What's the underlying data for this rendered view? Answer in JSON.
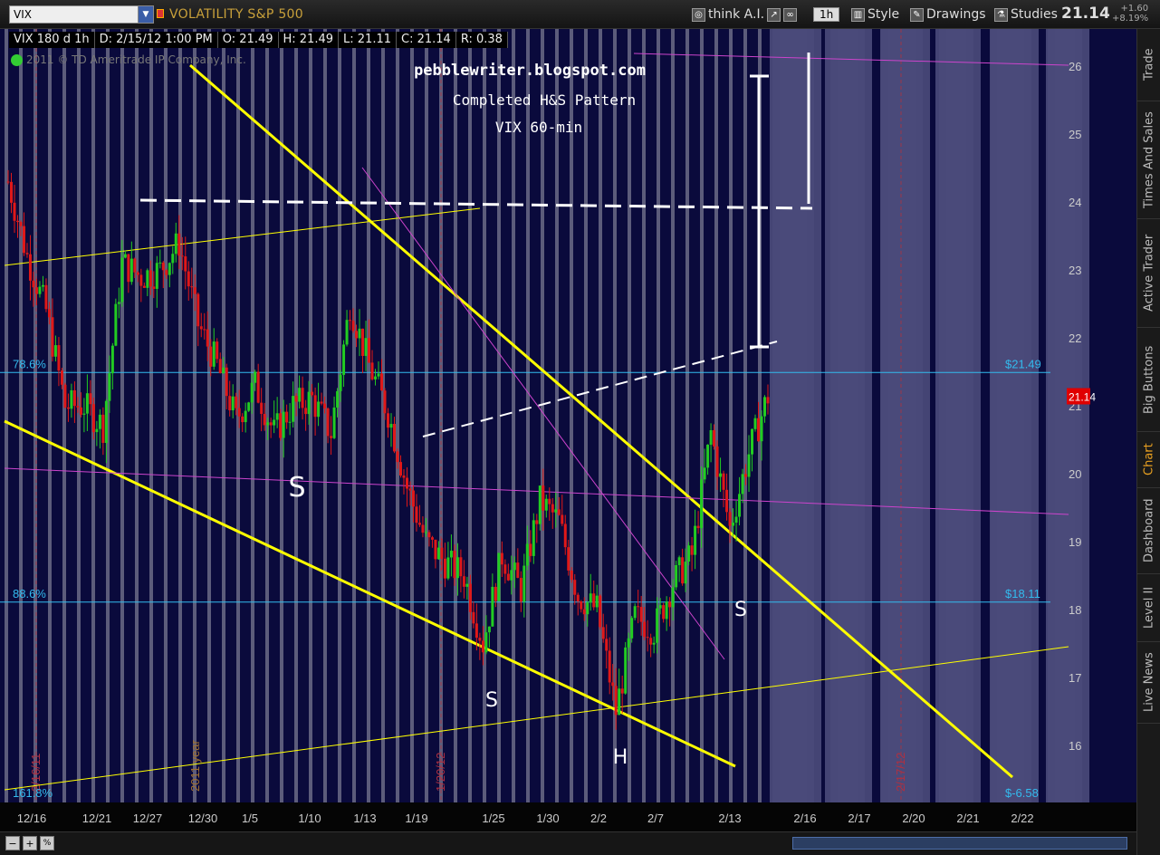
{
  "toolbar": {
    "symbol": "VIX",
    "description": "VOLATILITY S&P 500",
    "think_ai": "think A.I.",
    "period": "1h",
    "style": "Style",
    "drawings": "Drawings",
    "studies": "Studies",
    "last_price": "21.14",
    "net_change": "+1.60",
    "net_change_pct": "+8.19%"
  },
  "info_bar": {
    "symbol_period": "VIX 180 d 1h",
    "date": "D: 2/15/12 1:00 PM",
    "open": "O: 21.49",
    "high": "H: 21.49",
    "low": "L: 21.11",
    "close": "C: 21.14",
    "range": "R: 0.38"
  },
  "copyright": "2011 © TD Ameritrade IP Company, Inc.",
  "side_tabs": [
    "Trade",
    "Times And Sales",
    "Active Trader",
    "Big Buttons",
    "Chart",
    "Dashboard",
    "Level II",
    "Live News"
  ],
  "active_side_tab": "Chart",
  "bottom_bar": {
    "zoom_out": "−",
    "zoom_in": "+",
    "zoom_pct": "%"
  },
  "colors": {
    "background": "#0a0a3c",
    "stripe": "#787890",
    "future_stripe": "#4a4a7a",
    "up_candle": "#22cc22",
    "down_candle": "#e01818",
    "fib_line": "#33bbee",
    "trend_yellow": "#ffff00",
    "trend_magenta": "#cc44cc",
    "annotation": "#ffffff",
    "price_tag": "#e00000"
  },
  "chart_data": {
    "type": "candlestick",
    "title": "pebblewriter.blogspot.com",
    "subtitle_lines": [
      "Completed H&S Pattern",
      "VIX    60-min"
    ],
    "y_ticks": [
      16,
      17,
      18,
      19,
      20,
      21,
      22,
      23,
      24,
      25,
      26
    ],
    "x_ticks": [
      "12/16",
      "12/21",
      "12/27",
      "12/30",
      "1/5",
      "1/10",
      "1/13",
      "1/19",
      "1/25",
      "1/30",
      "2/2",
      "2/7",
      "2/13",
      "2/16",
      "2/17",
      "2/20",
      "2/21",
      "2/22"
    ],
    "vertical_labels": [
      "2/16/11",
      "2011 year",
      "1/20/12",
      "2/17/12"
    ],
    "fib_levels": [
      {
        "label": "78.6%",
        "value": 21.49,
        "price": "$21.49"
      },
      {
        "label": "88.6%",
        "value": 18.11,
        "price": "$18.11"
      },
      {
        "label": "161.8%",
        "value": 15.6,
        "price": "$-6.58"
      }
    ],
    "current_price": 21.14,
    "current_price_label": "21.14",
    "pattern_labels": [
      "S",
      "S",
      "H",
      "S"
    ],
    "daily_closes": [
      {
        "date": "12/16",
        "close": 24.3
      },
      {
        "date": "12/19",
        "close": 23.2
      },
      {
        "date": "12/20",
        "close": 22.4
      },
      {
        "date": "12/21",
        "close": 21.0
      },
      {
        "date": "12/22",
        "close": 21.0
      },
      {
        "date": "12/23",
        "close": 20.7
      },
      {
        "date": "12/27",
        "close": 23.1
      },
      {
        "date": "12/28",
        "close": 22.9
      },
      {
        "date": "12/29",
        "close": 23.0
      },
      {
        "date": "12/30",
        "close": 23.4
      },
      {
        "date": "1/3",
        "close": 22.2
      },
      {
        "date": "1/4",
        "close": 21.6
      },
      {
        "date": "1/5",
        "close": 20.8
      },
      {
        "date": "1/6",
        "close": 21.3
      },
      {
        "date": "1/9",
        "close": 20.6
      },
      {
        "date": "1/10",
        "close": 21.0
      },
      {
        "date": "1/11",
        "close": 21.1
      },
      {
        "date": "1/12",
        "close": 20.6
      },
      {
        "date": "1/13",
        "close": 22.5
      },
      {
        "date": "1/17",
        "close": 21.6
      },
      {
        "date": "1/18",
        "close": 20.9
      },
      {
        "date": "1/19",
        "close": 19.8
      },
      {
        "date": "1/20",
        "close": 19.0
      },
      {
        "date": "1/23",
        "close": 18.7
      },
      {
        "date": "1/24",
        "close": 18.5
      },
      {
        "date": "1/25",
        "close": 17.5
      },
      {
        "date": "1/26",
        "close": 18.8
      },
      {
        "date": "1/27",
        "close": 18.3
      },
      {
        "date": "1/30",
        "close": 19.6
      },
      {
        "date": "1/31",
        "close": 19.3
      },
      {
        "date": "2/1",
        "close": 18.2
      },
      {
        "date": "2/2",
        "close": 18.0
      },
      {
        "date": "2/3",
        "close": 16.5
      },
      {
        "date": "2/6",
        "close": 17.9
      },
      {
        "date": "2/7",
        "close": 17.7
      },
      {
        "date": "2/8",
        "close": 18.4
      },
      {
        "date": "2/9",
        "close": 18.8
      },
      {
        "date": "2/10",
        "close": 20.6
      },
      {
        "date": "2/13",
        "close": 19.2
      },
      {
        "date": "2/14",
        "close": 20.3
      },
      {
        "date": "2/15",
        "close": 21.14
      }
    ]
  }
}
